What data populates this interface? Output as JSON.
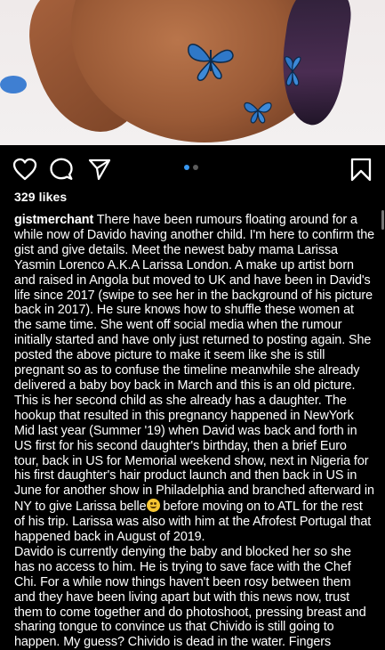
{
  "post": {
    "likes": "329 likes",
    "username": "gistmerchant",
    "caption_p1_a": " There have been rumours floating around for a while now of Davido having another child. I'm here to confirm the gist and give details. Meet the newest baby mama Larissa Yasmin Lorenco A.K.A Larissa London. A make up artist born and raised in Angola but moved to UK and have been in David's life since 2017 (swipe to see her in the background of his picture back in 2017). He sure knows how to shuffle these women at the same time. She went off social media when the rumour initially started and have only just returned to posting again. She posted the above picture to make it seem like she is still pregnant so as to confuse the timeline meanwhile she already delivered a baby boy back in March and this is an old picture. This is her second child as she already has a daughter. The hookup that resulted in this pregnancy happened in NewYork Mid last year (Summer '19) when David was back and forth in US first for his second daughter's birthday, then a brief Euro tour, back in US for Memorial weekend show, next in Nigeria for his first daughter's  hair product launch and then back in US in June for another show in Philadelphia and branched afterward in NY to give Larissa belle",
    "caption_p1_b": " before moving on to ATL for the rest of his trip. Larissa was also with him at the Afrofest Portugal that happened back in August of 2019.",
    "caption_p2": "Davido is currently denying the baby and blocked her so she has no access to him. He is trying to save face with the Chef Chi. For a while now things haven't been rosy between them and they have been living apart but with this news now, trust them to come together and do photoshoot, pressing breast and sharing tongue to convince us that Chivido is still going to happen. My guess? Chivido is dead in the water. Fingers",
    "carousel": {
      "count": 2,
      "active_index": 0
    }
  },
  "icons": {
    "like": "heart-icon",
    "comment": "comment-bubble-icon",
    "share": "paper-plane-icon",
    "save": "bookmark-icon",
    "emoji": "smiling-face-emoji",
    "photo_decor": "blue-butterfly-icon"
  },
  "colors": {
    "background": "#000000",
    "text": "#ffffff",
    "carousel_active": "#3897f0",
    "carousel_inactive": "#5b5b5b",
    "butterfly": "#2f78c8"
  }
}
